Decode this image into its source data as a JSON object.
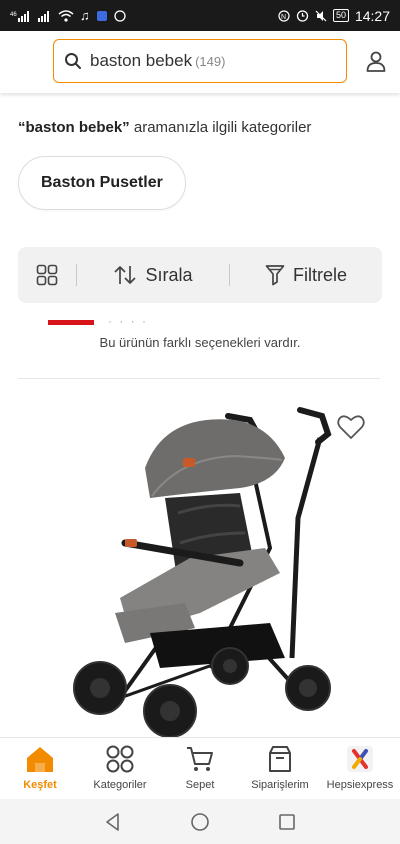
{
  "status_bar": {
    "signal_left": "46",
    "battery": "50",
    "time": "14:27"
  },
  "search": {
    "query": "baston bebek",
    "count": "(149)"
  },
  "categories": {
    "query_quoted": "“baston bebek”",
    "suffix": " aramanızla ilgili kategoriler",
    "chip_label": "Baston Pusetler"
  },
  "toolbar": {
    "sort_label": "Sırala",
    "filter_label": "Filtrele"
  },
  "product_list": {
    "variant_note": "Bu ürünün farklı seçenekleri vardır."
  },
  "bottom_nav": {
    "items": [
      {
        "label": "Keşfet",
        "icon": "home-icon"
      },
      {
        "label": "Kategoriler",
        "icon": "categories-icon"
      },
      {
        "label": "Sepet",
        "icon": "cart-icon"
      },
      {
        "label": "Siparişlerim",
        "icon": "orders-icon"
      },
      {
        "label": "Hepsiexpress",
        "icon": "hepsiexpress-icon"
      }
    ]
  },
  "colors": {
    "accent": "#f28b00",
    "brand_red": "#d8141b"
  }
}
